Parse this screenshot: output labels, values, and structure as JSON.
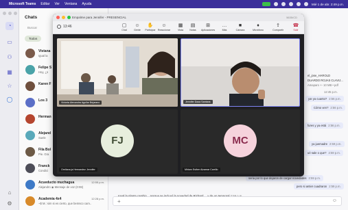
{
  "menubar": {
    "app_name": "Microsoft Teams",
    "menus": [
      "Editar",
      "Ver",
      "Ventana",
      "Ayuda"
    ],
    "clock": "Mié 1 de abr. 2:49 p.m."
  },
  "chats": {
    "title": "Chats",
    "search_placeholder": "Buscar",
    "filter_pill": "Todos",
    "items": [
      {
        "name": "Viviana",
        "preview": "Igual la",
        "time": "",
        "avatar_color": "#7a5a4a"
      },
      {
        "name": "Felipe S",
        "preview": "Hoy, ¿s",
        "time": "",
        "avatar_color": "#4aa3a8"
      },
      {
        "name": "Karen F",
        "preview": "",
        "time": "",
        "avatar_color": "#6f4f3d"
      },
      {
        "name": "Los 3",
        "preview": "",
        "time": "",
        "avatar_color": "#5b6fc7"
      },
      {
        "name": "Herman",
        "preview": "",
        "time": "",
        "avatar_color": "#b5462f"
      },
      {
        "name": "Alejand",
        "preview": "Suele",
        "time": "",
        "avatar_color": "#59a9ba"
      },
      {
        "name": "Fila Bol",
        "preview": "Pie. Gra",
        "time": "",
        "avatar_color": "#6d5a46"
      },
      {
        "name": "Franck",
        "preview": "Condici",
        "time": "",
        "avatar_color": "#4e4e58"
      },
      {
        "name": "Acueducto muchagua",
        "preview": "Alejandro ◉ Mensaje de voz (0:08)",
        "time": "12:55 p.m.",
        "avatar_color": "#3e7ac7"
      },
      {
        "name": "Academia 4x4",
        "preview": "~$ M.: sim si es cierto, que bemsco cam..",
        "time": "12:28 p.m.",
        "avatar_color": "#d88a2a"
      }
    ]
  },
  "chat_area": {
    "messages": [
      {
        "text": "el_jose_HAROLD",
        "time": ""
      },
      {
        "text": "DUARDO ROJAS CLAVIJ...",
        "time": ""
      },
      {
        "text": "Amaparo +- 10 MB • pdf",
        "time": ""
      },
      {
        "text": "12:45 p.m.",
        "time": ""
      },
      {
        "text": "ya! ya cuanto?",
        "time": "2:56 p.m."
      },
      {
        "text": "Cómo ven?",
        "time": "2:56 p.m."
      },
      {
        "text": "fures y ya está",
        "time": "2:56 p.m."
      },
      {
        "text": "ya juemadre",
        "time": "2:59 p.m."
      },
      {
        "text": "ué sale o que?",
        "time": "2:59 p.m."
      },
      {
        "text": "seria por lo que dejaron de cargar novedades",
        "time": "2:59 p.m."
      },
      {
        "text": "pero si antier cuadraron",
        "time": "2:59 p.m."
      }
    ],
    "last_message": "Igual la planta cambio... porque se incluyó la novedad de Richard.... y de un temporal",
    "last_message_time": "2:59 p.m."
  },
  "meeting": {
    "window_title": "Empalme para Jennifer - PRESENCIAL",
    "session_id": "5635/CD",
    "elapsed": "13:46",
    "toolbar": [
      {
        "label": "Chat",
        "icon": "chat-icon",
        "glyph": "▢"
      },
      {
        "label": "Gente",
        "icon": "people-icon",
        "glyph": "☺"
      },
      {
        "label": "Participar",
        "icon": "raise-hand-icon",
        "glyph": "✋"
      },
      {
        "label": "Reaccionar",
        "icon": "reaction-icon",
        "glyph": "☺"
      },
      {
        "label": "Vista",
        "icon": "view-icon",
        "glyph": "▦"
      },
      {
        "label": "Notas",
        "icon": "notes-icon",
        "glyph": "▤"
      },
      {
        "label": "Aplicaciones",
        "icon": "apps-icon",
        "glyph": "⊞"
      },
      {
        "label": "Más",
        "icon": "more-icon",
        "glyph": "…"
      },
      {
        "label": "Cámara",
        "icon": "camera-icon",
        "glyph": "■"
      },
      {
        "label": "Micrófono",
        "icon": "microphone-icon",
        "glyph": "♦"
      },
      {
        "label": "Compartir",
        "icon": "share-icon",
        "glyph": "⇪"
      },
      {
        "label": "Salir",
        "icon": "leave-icon",
        "glyph": "☎"
      }
    ],
    "participants": [
      {
        "name": "Victoria Alexandra Aguilar Bejarano",
        "initials": "",
        "video": true
      },
      {
        "name": "Jennifer Daza Santana",
        "initials": "",
        "video": true
      },
      {
        "name": "Orellana ja Hernandez Jennifer",
        "initials": "FJ",
        "video": false,
        "avatar_bg": "#e7eedd",
        "avatar_fg": "#3f4b34"
      },
      {
        "name": "Miriam Esther Alzamar Carrillo",
        "initials": "MC",
        "video": false,
        "avatar_bg": "#f6d3dc",
        "avatar_fg": "#8a2b4d"
      }
    ]
  }
}
